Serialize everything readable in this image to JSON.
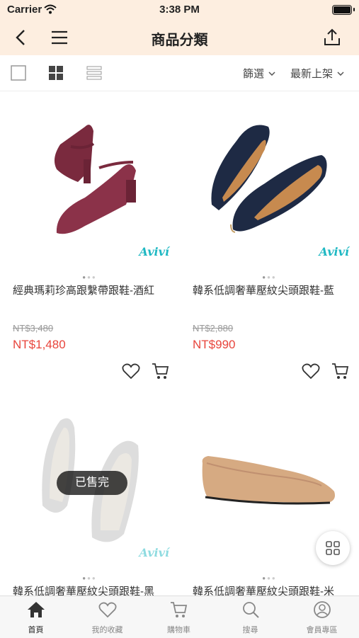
{
  "status_bar": {
    "carrier": "Carrier",
    "time": "3:38 PM"
  },
  "header": {
    "title": "商品分類"
  },
  "toolbar": {
    "filter_label": "篩選",
    "sort_label": "最新上架"
  },
  "products": [
    {
      "name": "經典瑪莉珍高跟繫帶跟鞋-酒紅",
      "original_price": "NT$3,480",
      "price": "NT$1,480",
      "brand": "Aviví",
      "sold_out": false
    },
    {
      "name": "韓系低調奢華壓紋尖頭跟鞋-藍",
      "original_price": "NT$2,880",
      "price": "NT$990",
      "brand": "Aviví",
      "sold_out": false
    },
    {
      "name": "韓系低調奢華壓紋尖頭跟鞋-黑",
      "brand": "Aviví",
      "sold_out": true,
      "sold_out_label": "已售完"
    },
    {
      "name": "韓系低調奢華壓紋尖頭跟鞋-米",
      "sold_out": false
    }
  ],
  "tab_bar": {
    "items": [
      {
        "label": "首頁",
        "icon": "home-icon",
        "active": true
      },
      {
        "label": "我的收藏",
        "icon": "heart-icon",
        "active": false
      },
      {
        "label": "購物車",
        "icon": "cart-icon",
        "active": false
      },
      {
        "label": "搜尋",
        "icon": "search-icon",
        "active": false
      },
      {
        "label": "會員專區",
        "icon": "user-icon",
        "active": false
      }
    ]
  },
  "colors": {
    "header_bg": "#fdeee0",
    "price": "#e8453c",
    "brand": "#1fb8c3"
  }
}
